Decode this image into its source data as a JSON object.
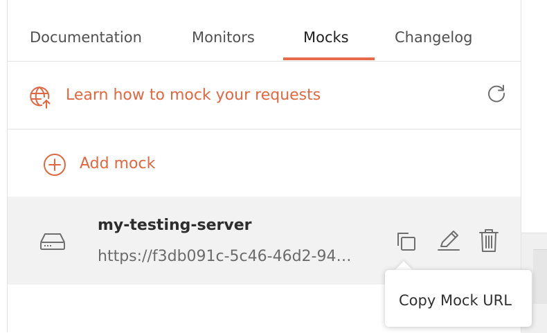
{
  "tabs": [
    {
      "label": "Documentation"
    },
    {
      "label": "Monitors"
    },
    {
      "label": "Mocks"
    },
    {
      "label": "Changelog"
    }
  ],
  "active_tab": "Mocks",
  "learn_link": {
    "label": "Learn how to mock your requests",
    "icon": "globe-upload-icon"
  },
  "refresh": {
    "icon": "refresh-icon"
  },
  "add_mock": {
    "label": "Add mock",
    "icon": "plus-circle-icon"
  },
  "mock": {
    "name": "my-testing-server",
    "url": "https://f3db091c-5c46-46d2-94…",
    "icon": "server-icon",
    "actions": [
      "copy-icon",
      "edit-icon",
      "delete-icon"
    ]
  },
  "tooltip": {
    "label": "Copy Mock URL"
  },
  "colors": {
    "accent": "#e0673f",
    "row_bg": "#f2f2f2",
    "divider": "#e3e3e3"
  }
}
